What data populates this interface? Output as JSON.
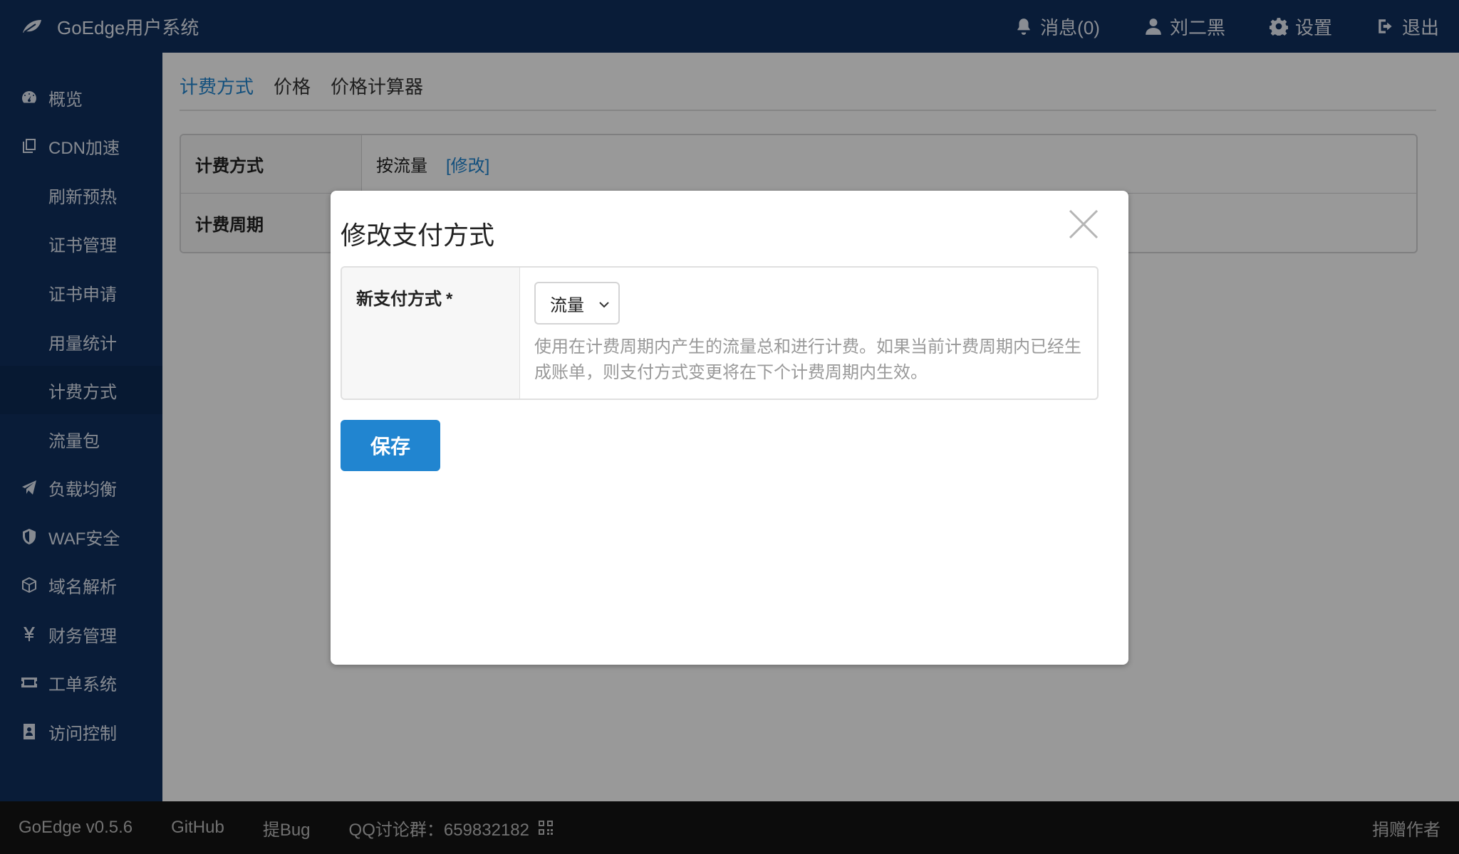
{
  "header": {
    "brand": "GoEdge用户系统",
    "messages": "消息(0)",
    "user": "刘二黑",
    "settings": "设置",
    "logout": "退出"
  },
  "sidebar": {
    "items": [
      {
        "label": "概览",
        "icon": "dashboard-icon"
      },
      {
        "label": "CDN加速",
        "icon": "copy-icon"
      },
      {
        "label": "刷新预热",
        "icon": ""
      },
      {
        "label": "证书管理",
        "icon": ""
      },
      {
        "label": "证书申请",
        "icon": ""
      },
      {
        "label": "用量统计",
        "icon": ""
      },
      {
        "label": "计费方式",
        "icon": "",
        "active": true
      },
      {
        "label": "流量包",
        "icon": ""
      },
      {
        "label": "负载均衡",
        "icon": "paper-plane-icon"
      },
      {
        "label": "WAF安全",
        "icon": "shield-icon"
      },
      {
        "label": "域名解析",
        "icon": "cube-icon"
      },
      {
        "label": "财务管理",
        "icon": "yen-icon"
      },
      {
        "label": "工单系统",
        "icon": "ticket-icon"
      },
      {
        "label": "访问控制",
        "icon": "id-card-icon"
      }
    ]
  },
  "tabs": [
    "计费方式",
    "价格",
    "价格计算器"
  ],
  "info": {
    "rows": [
      {
        "key": "计费方式",
        "value": "按流量",
        "link": "[修改]"
      },
      {
        "key": "计费周期",
        "value": ""
      }
    ]
  },
  "modal": {
    "title": "修改支付方式",
    "field_label": "新支付方式",
    "required_mark": "*",
    "select_value": "流量",
    "help": "使用在计费周期内产生的流量总和进行计费。如果当前计费周期内已经生成账单，则支付方式变更将在下个计费周期内生效。",
    "save_label": "保存"
  },
  "footer": {
    "version": "GoEdge v0.5.6",
    "github": "GitHub",
    "bug": "提Bug",
    "qq": "QQ讨论群：659832182",
    "donate": "捐赠作者"
  },
  "colors": {
    "nav_bg": "#0f2f5e",
    "accent": "#2185d0",
    "footer_bg": "#141414"
  }
}
